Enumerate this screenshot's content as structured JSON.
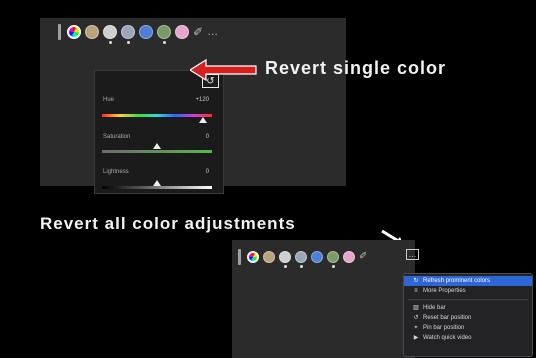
{
  "annotations": {
    "revert_single": "Revert single color",
    "revert_all": "Revert all color adjustments"
  },
  "colors": {
    "arrow_red": "#d62020",
    "menu_highlight": "#2f66d6",
    "panel_bg": "#2b2b2b"
  },
  "toolbar": {
    "swatches": [
      {
        "name": "all-colors",
        "fill": "conic-gradient(red, yellow, lime, cyan, blue, magenta, red)",
        "selected": true,
        "dot": false
      },
      {
        "name": "color-2",
        "fill": "#b9a37a",
        "selected": false,
        "dot": false
      },
      {
        "name": "color-3",
        "fill": "#cfcfcf",
        "selected": false,
        "dot": true
      },
      {
        "name": "color-4",
        "fill": "#9aa7b7",
        "selected": false,
        "dot": true
      },
      {
        "name": "color-5",
        "fill": "#4d7fd6",
        "selected": false,
        "dot": false
      },
      {
        "name": "color-6",
        "fill": "#7a9a66",
        "selected": false,
        "dot": true
      },
      {
        "name": "color-7",
        "fill": "#e7a6c9",
        "selected": false,
        "dot": false
      }
    ],
    "eyedropper_icon": "eyedropper-icon",
    "more_icon": "more-icon",
    "more_glyph": "…"
  },
  "adjustments": {
    "revert_glyph": "↺",
    "sliders": [
      {
        "label": "Hue",
        "value": "+120",
        "level": 0.92
      },
      {
        "label": "Saturation",
        "value": "0",
        "level": 0.5
      },
      {
        "label": "Lightness",
        "value": "0",
        "level": 0.5
      }
    ]
  },
  "menu": {
    "items": [
      {
        "label": "Refresh prominent colors",
        "icon": "refresh-icon",
        "glyph": "↻",
        "selected": true
      },
      {
        "label": "More Properties",
        "icon": "sliders-icon",
        "glyph": "≡",
        "selected": false
      },
      {
        "divider": true
      },
      {
        "label": "Hide bar",
        "icon": "hide-icon",
        "glyph": "▨",
        "selected": false
      },
      {
        "label": "Reset bar position",
        "icon": "reset-icon",
        "glyph": "↺",
        "selected": false
      },
      {
        "label": "Pin bar position",
        "icon": "pin-icon",
        "glyph": "⌖",
        "selected": false
      },
      {
        "label": "Watch quick video",
        "icon": "play-icon",
        "glyph": "▶",
        "selected": false
      }
    ]
  }
}
